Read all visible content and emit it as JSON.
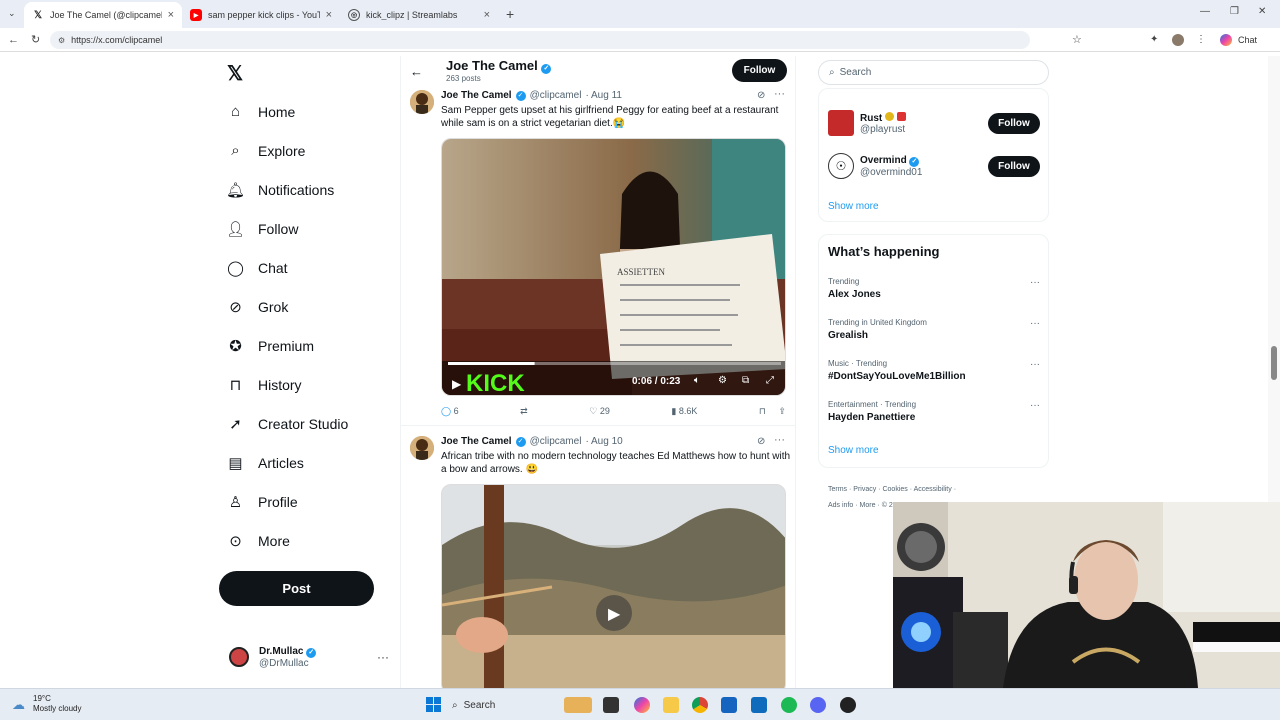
{
  "browser": {
    "tabs": [
      {
        "title": "Joe The Camel (@clipcamel) / X",
        "icon": "x-logo-icon",
        "active": true
      },
      {
        "title": "sam pepper kick clips - YouTube",
        "icon": "youtube-icon",
        "active": false
      },
      {
        "title": "kick_clipz | Streamlabs",
        "icon": "globe-icon",
        "active": false
      }
    ],
    "url": "https://x.com/clipcamel",
    "chat_label": "Chat"
  },
  "left_nav": {
    "items": [
      {
        "label": "Home",
        "icon": "home-icon"
      },
      {
        "label": "Explore",
        "icon": "search-icon"
      },
      {
        "label": "Notifications",
        "icon": "bell-icon"
      },
      {
        "label": "Follow",
        "icon": "person-add-icon"
      },
      {
        "label": "Chat",
        "icon": "chat-bubble-icon"
      },
      {
        "label": "Grok",
        "icon": "grok-icon"
      },
      {
        "label": "Premium",
        "icon": "premium-badge-icon"
      },
      {
        "label": "History",
        "icon": "bookmark-icon"
      },
      {
        "label": "Creator Studio",
        "icon": "rocket-icon"
      },
      {
        "label": "Articles",
        "icon": "articles-icon"
      },
      {
        "label": "Profile",
        "icon": "person-icon"
      },
      {
        "label": "More",
        "icon": "more-circle-icon"
      }
    ],
    "post_label": "Post",
    "user": {
      "name": "Dr.Mullac",
      "handle": "@DrMullac"
    }
  },
  "header": {
    "name": "Joe The Camel",
    "posts_count": "263 posts",
    "follow_label": "Follow"
  },
  "tweets": [
    {
      "name": "Joe The Camel",
      "handle": "@clipcamel",
      "date": "· Aug 11",
      "text": "Sam Pepper gets upset at his girlfriend Peggy for eating beef at a restaurant while sam is on a strict vegetarian diet.😭",
      "video_time": "0:06 / 0:23",
      "progress": 0.26,
      "watermark": "KICK",
      "menu_card": {
        "title": "ASSIETTEN"
      },
      "stats": {
        "replies": "6",
        "retweets": "",
        "likes": "29",
        "views": "8.6K"
      }
    },
    {
      "name": "Joe The Camel",
      "handle": "@clipcamel",
      "date": "· Aug 10",
      "text": "African tribe with no modern technology teaches Ed Matthews how to hunt with a bow and arrows. 😃"
    }
  ],
  "right": {
    "search_placeholder": "Search",
    "who_to_follow": [
      {
        "name": "Rust",
        "handle": "@playrust",
        "follow": "Follow"
      },
      {
        "name": "Overmind",
        "handle": "@overmind01",
        "follow": "Follow"
      }
    ],
    "show_more": "Show more",
    "happening_title": "What’s happening",
    "trends": [
      {
        "context": "Trending",
        "name": "Alex Jones"
      },
      {
        "context": "Trending in United Kingdom",
        "name": "Grealish"
      },
      {
        "context": "Music · Trending",
        "name": "#DontSayYouLoveMe1Billion"
      },
      {
        "context": "Entertainment · Trending",
        "name": "Hayden Panettiere"
      }
    ],
    "show_more_2": "Show more",
    "footer_links": [
      "Terms",
      "Privacy",
      "Cookies",
      "Accessibility",
      "Ads info",
      "More",
      "© 2025 X Corp."
    ]
  },
  "taskbar": {
    "weather_temp": "19°C",
    "weather_desc": "Mostly cloudy",
    "search_label": "Search"
  },
  "colors": {
    "accent": "#1d9bf0",
    "text": "#0f1419",
    "kick_green": "#53fc18"
  }
}
